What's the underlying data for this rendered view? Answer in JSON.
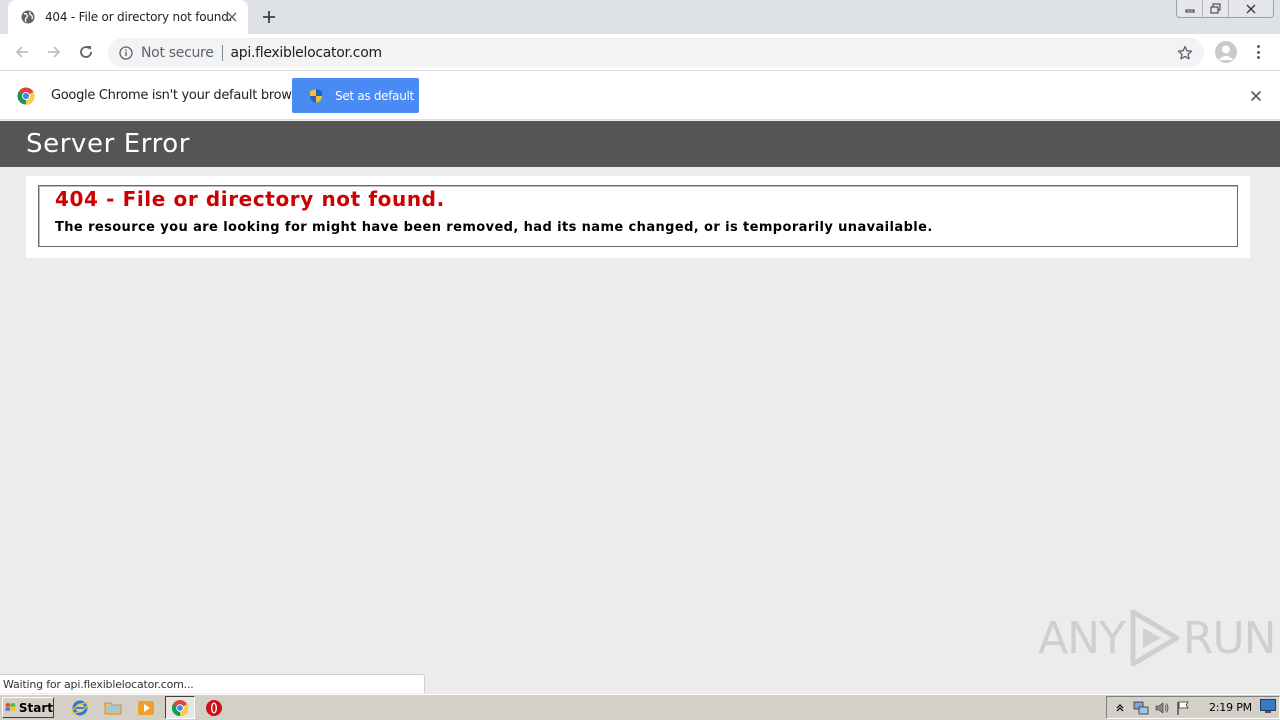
{
  "browser": {
    "tab": {
      "title": "404 - File or directory not found.",
      "favicon": "globe-icon"
    },
    "new_tab": "+",
    "omnibox": {
      "security": "Not secure",
      "url": "api.flexiblelocator.com"
    }
  },
  "infobar": {
    "message": "Google Chrome isn't your default browser",
    "button_label": "Set as default"
  },
  "page": {
    "header": "Server Error",
    "error_title": "404 - File or directory not found.",
    "error_desc": "The resource you are looking for might have been removed, had its name changed, or is temporarily unavailable."
  },
  "status_bar": {
    "text": "Waiting for api.flexiblelocator.com..."
  },
  "watermark": {
    "left": "ANY",
    "right": "RUN"
  },
  "taskbar": {
    "start_label": "Start",
    "clock": "2:19 PM",
    "pinned": [
      "internet-explorer-icon",
      "folder-icon",
      "media-player-icon",
      "chrome-icon",
      "opera-icon"
    ]
  },
  "colors": {
    "header_bg": "#555555",
    "error_red": "#cc0000",
    "button_blue": "#4a8af4",
    "page_bg": "#ececec"
  }
}
